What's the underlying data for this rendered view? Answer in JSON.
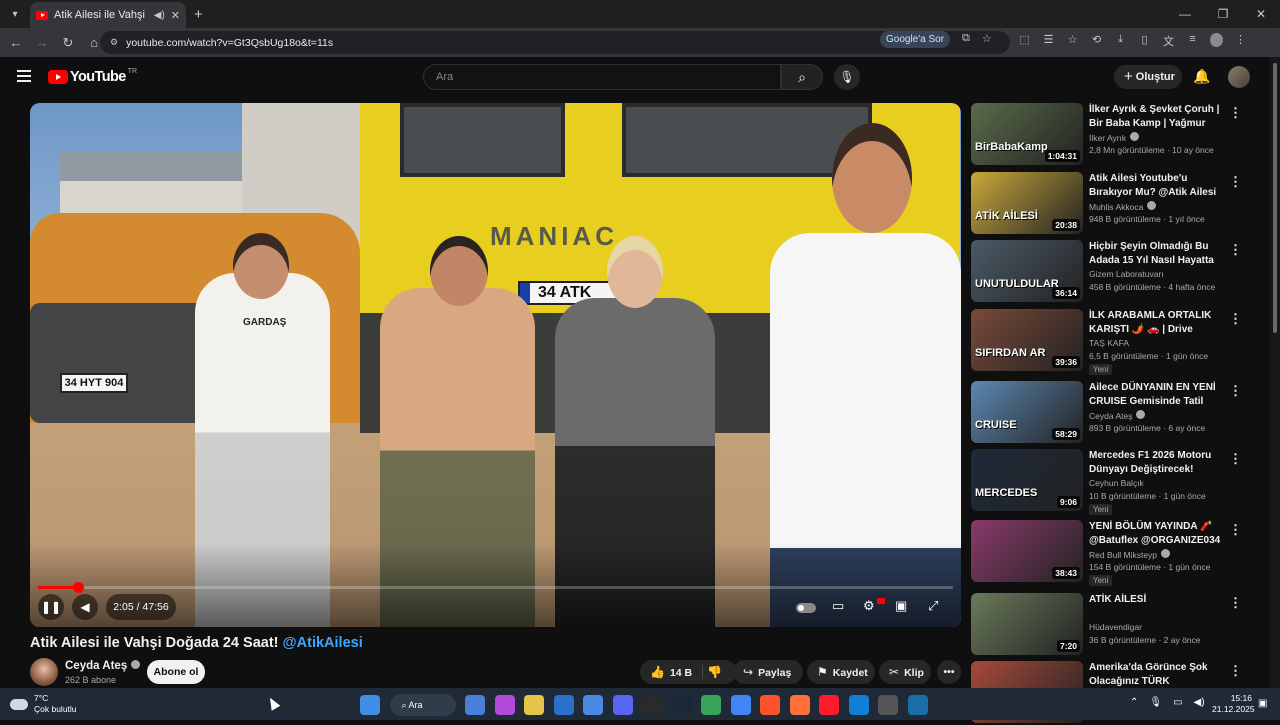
{
  "browser": {
    "tab_title": "Atik Ailesi ile Vahşi Doğada",
    "url": "youtube.com/watch?v=Gt3QsbUg18o&t=11s",
    "google_sor": "Google'a Sor"
  },
  "youtube": {
    "logo_text": "YouTube",
    "region": "TR",
    "search_placeholder": "Ara",
    "create_label": "Oluştur"
  },
  "player": {
    "time": "2:05 / 47:56",
    "progress_fraction": 0.0436,
    "skip_hint": "+20"
  },
  "video": {
    "title_main": "Atik Ailesi ile Vahşi Doğada 24 Saat!",
    "title_tag": "@AtikAilesi",
    "channel": "Ceyda Ateş",
    "subscribers": "262 B abone",
    "subscribe_label": "Abone ol",
    "likes": "14 B",
    "share_label": "Paylaş",
    "save_label": "Kaydet",
    "clip_label": "Klip",
    "scene": {
      "truck_brand": "MANIAC",
      "truck_plate": "34 ATK",
      "car_plate": "34 HYT 904",
      "shirt_text": "GARDAŞ"
    }
  },
  "recommendations": [
    {
      "title": "İlker Ayrık & Şevket Çoruh | Bir Baba Kamp | Yağmur Dinmedi,...",
      "channel": "İlker Ayrık",
      "verified": true,
      "meta": "2,8 Mn görüntüleme · 10 ay önce",
      "duration": "1:04:31",
      "badge": "",
      "thumb_text": "BirBabaKamp",
      "thumb_color": "#5a6b4a"
    },
    {
      "title": "Atik Ailesi Youtube'u Bırakıyor Mu? @Atik Ailesi",
      "channel": "Muhlis Akkoca",
      "verified": true,
      "meta": "948 B görüntüleme · 1 yıl önce",
      "duration": "20:38",
      "badge": "",
      "thumb_text": "ATİK AİLESİ",
      "thumb_color": "#c9a93b"
    },
    {
      "title": "Hiçbir Şeyin Olmadığı Bu Adada 15 Yıl Nasıl Hayatta Kaldılar?",
      "channel": "Gizem Laboratuvarı",
      "verified": false,
      "meta": "458 B görüntüleme · 4 hafta önce",
      "duration": "36:14",
      "badge": "",
      "thumb_text": "UNUTULDULAR",
      "thumb_color": "#4b5a66"
    },
    {
      "title": "İLK ARABAMLA ORTALIK KARIŞTI 🌶️ 🚗 | Drive Beyond ...",
      "channel": "TAŞ KAFA",
      "verified": false,
      "meta": "6,5 B görüntüleme · 1 gün önce",
      "duration": "39:36",
      "badge": "Yeni",
      "thumb_text": "SIFIRDAN AR",
      "thumb_color": "#7a4a3a"
    },
    {
      "title": "Ailece DÜNYANIN EN YENİ CRUISE Gemisinde Tatil Yaptık...",
      "channel": "Ceyda Ateş",
      "verified": true,
      "meta": "893 B görüntüleme · 6 ay önce",
      "duration": "58:29",
      "badge": "",
      "thumb_text": "CRUISE",
      "thumb_color": "#5d88b0"
    },
    {
      "title": "Mercedes F1 2026 Motoru Dünyayı Değiştirecek! Esneyen...",
      "channel": "Ceyhun Balçık",
      "verified": false,
      "meta": "10 B görüntüleme · 1 gün önce",
      "duration": "9:06",
      "badge": "Yeni",
      "thumb_text": "MERCEDES",
      "thumb_color": "#1e2a3a"
    },
    {
      "title": "YENİ BÖLÜM YAYINDA 🧨 @Batuflex @ORGANIZE034 ...",
      "channel": "Red Bull Miksteyp",
      "verified": true,
      "meta": "154 B görüntüleme · 1 gün önce",
      "duration": "38:43",
      "badge": "Yeni",
      "thumb_text": "",
      "thumb_color": "#8a3a6a"
    },
    {
      "title": "ATİK AİLESİ",
      "channel": "Hüdavendigar",
      "verified": false,
      "meta": "36 B görüntüleme · 2 ay önce",
      "duration": "7:20",
      "badge": "",
      "thumb_text": "",
      "thumb_color": "#6a7a5a"
    },
    {
      "title": "Amerika'da Görünce Şok Olacağınız TÜRK ÜRÜNLERİ! ...",
      "channel": "",
      "verified": false,
      "meta": "",
      "duration": "",
      "badge": "",
      "thumb_text": "",
      "thumb_color": "#a84a3a"
    }
  ],
  "taskbar": {
    "temp": "7°C",
    "weather": "Çok bulutlu",
    "search_label": "Ara",
    "time": "15:16",
    "date": "21.12.2025",
    "app_colors": [
      "#4a7fd9",
      "#b04ad9",
      "#e6c34a",
      "#2a6fc9",
      "#4a8ae6",
      "#5865f2",
      "#2a2a2a",
      "#1b2838",
      "#3aa35a",
      "#4285f4",
      "#fb542b",
      "#ff7139",
      "#ff1b2d",
      "#0f7fd8",
      "#555",
      "#1b6fa8"
    ]
  },
  "colors": {
    "accent_red": "#ff0000",
    "link_blue": "#3ea6ff"
  }
}
